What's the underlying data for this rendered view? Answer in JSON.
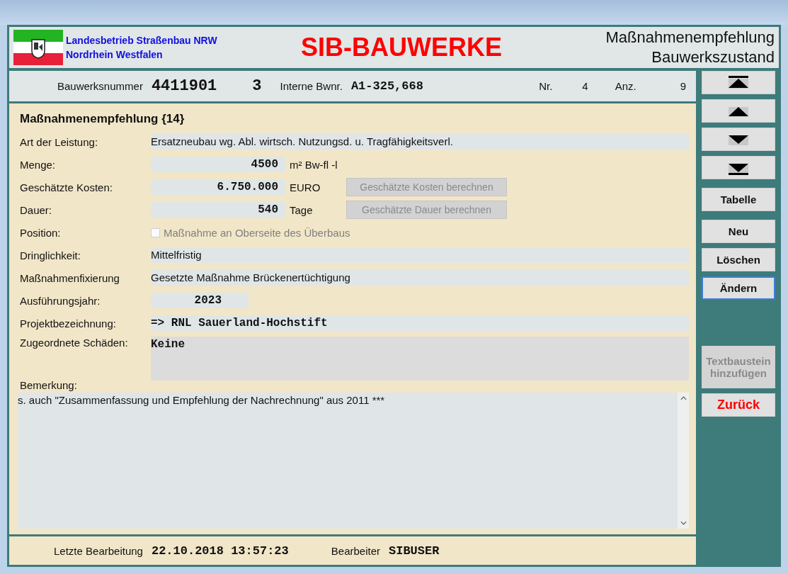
{
  "header": {
    "org_line_1": "Landesbetrieb Straßenbau NRW",
    "org_line_2": "Nordrhein Westfalen",
    "app_title": "SIB-BAUWERKE",
    "form_title_1": "Maßnahmenempfehlung",
    "form_title_2": "Bauwerkszustand"
  },
  "record_bar": {
    "bw_label": "Bauwerksnummer",
    "bw_number": "4411901",
    "bw_index": "3",
    "intern_label": "Interne Bwnr.",
    "intern_value": "A1-325,668",
    "nr_label": "Nr.",
    "nr_value": "4",
    "count_label": "Anz.",
    "count_value": "9"
  },
  "section_title": "Maßnahmenempfehlung  {14}",
  "fields": [
    {
      "kind": "text",
      "label": "Art der Leistung:",
      "value": "Ersatzneubau wg. Abl. wirtsch. Nutzungsd. u. Tragfähigkeitsverl."
    },
    {
      "kind": "number",
      "label": "Menge:",
      "value": "4500",
      "unit": "m² Bw-fl -l"
    },
    {
      "kind": "number",
      "label": "Geschätzte Kosten:",
      "value": "6.750.000",
      "unit": "EURO",
      "button": {
        "label": "Geschätzte Kosten berechnen",
        "disabled": true
      }
    },
    {
      "kind": "number",
      "label": "Dauer:",
      "value": "540",
      "unit": "Tage",
      "button": {
        "label": "Geschätzte Dauer berechnen",
        "disabled": true
      }
    },
    {
      "kind": "checkbox",
      "label": "Position:",
      "text": "Maßnahme an Oberseite des Überbaus",
      "checked": false,
      "disabled": true
    },
    {
      "kind": "text",
      "label": "Dringlichkeit:",
      "value": "Mittelfristig"
    },
    {
      "kind": "text",
      "label": "Maßnahmenfixierung",
      "value": "Gesetzte Maßnahme Brückenertüchtigung"
    },
    {
      "kind": "year",
      "label": "Ausführungsjahr:",
      "value": "2023"
    },
    {
      "kind": "mono",
      "label": "Projektbezeichnung:",
      "value": "=> RNL Sauerland-Hochstift"
    },
    {
      "kind": "memo",
      "label": "Zugeordnete Schäden:",
      "value": "Keine"
    }
  ],
  "remark": {
    "label": "Bemerkung:",
    "value": "s. auch \"Zusammenfassung und Empfehlung der Nachrechnung\" aus 2011 ***"
  },
  "footer": {
    "edited_label": "Letzte Bearbeitung",
    "edited_value": "22.10.2018 13:57:23",
    "editor_label": "Bearbeiter",
    "editor_value": "SIBUSER"
  },
  "side_buttons": [
    {
      "kind": "first"
    },
    {
      "kind": "prev"
    },
    {
      "kind": "next"
    },
    {
      "kind": "last"
    },
    {
      "kind": "text",
      "label": "Tabelle",
      "disabled": false,
      "focused": false
    },
    {
      "kind": "text",
      "label": "Neu",
      "disabled": false,
      "focused": false
    },
    {
      "kind": "text",
      "label": "Löschen",
      "disabled": false,
      "focused": false
    },
    {
      "kind": "text",
      "label": "Ändern",
      "disabled": false,
      "focused": true
    },
    {
      "kind": "text",
      "label": "Textbaustein hinzufügen",
      "disabled": true,
      "focused": false
    },
    {
      "kind": "back",
      "label": "Zurück",
      "disabled": false,
      "focused": false
    }
  ]
}
